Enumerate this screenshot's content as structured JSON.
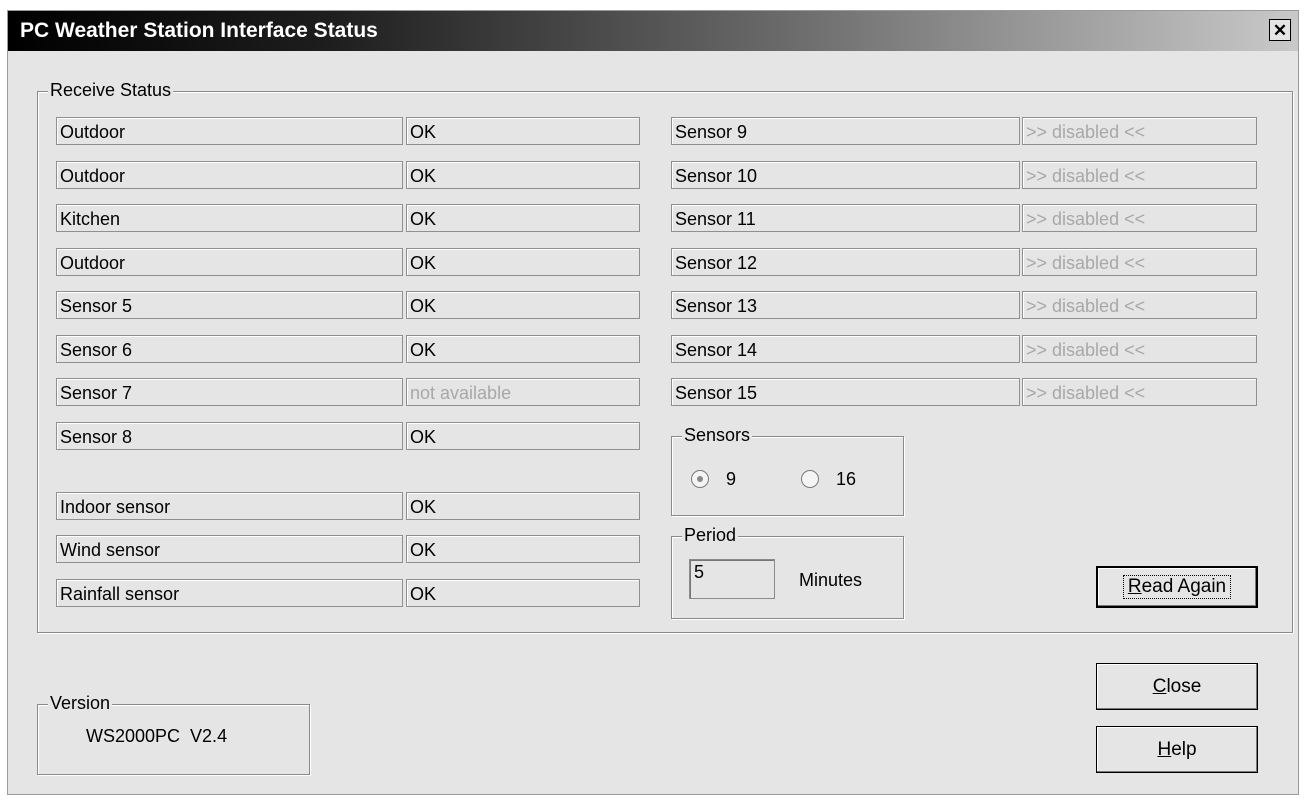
{
  "window": {
    "title": "PC Weather Station Interface Status",
    "close_glyph": "✕"
  },
  "receive_status": {
    "label": "Receive Status",
    "left_rows": [
      {
        "name": "Outdoor",
        "status": "OK"
      },
      {
        "name": "Outdoor",
        "status": "OK"
      },
      {
        "name": "Kitchen",
        "status": "OK"
      },
      {
        "name": "Outdoor",
        "status": "OK"
      },
      {
        "name": "Sensor 5",
        "status": "OK"
      },
      {
        "name": "Sensor 6",
        "status": "OK"
      },
      {
        "name": "Sensor 7",
        "status": "not available"
      },
      {
        "name": "Sensor 8",
        "status": "OK"
      }
    ],
    "extra_rows": [
      {
        "name": "Indoor sensor",
        "status": "OK"
      },
      {
        "name": "Wind sensor",
        "status": "OK"
      },
      {
        "name": "Rainfall sensor",
        "status": "OK"
      }
    ],
    "right_rows": [
      {
        "name": "Sensor 9",
        "status": ">> disabled <<"
      },
      {
        "name": "Sensor 10",
        "status": ">> disabled <<"
      },
      {
        "name": "Sensor 11",
        "status": ">> disabled <<"
      },
      {
        "name": "Sensor 12",
        "status": ">> disabled <<"
      },
      {
        "name": "Sensor 13",
        "status": ">> disabled <<"
      },
      {
        "name": "Sensor 14",
        "status": ">> disabled <<"
      },
      {
        "name": "Sensor 15",
        "status": ">> disabled <<"
      }
    ]
  },
  "sensors": {
    "label": "Sensors",
    "options": [
      "9",
      "16"
    ],
    "selected": "9"
  },
  "period": {
    "label": "Period",
    "value": "5",
    "unit": "Minutes"
  },
  "buttons": {
    "read_again": {
      "mnemonic": "R",
      "rest": "ead Again"
    },
    "close": {
      "mnemonic": "C",
      "rest": "lose"
    },
    "help": {
      "mnemonic": "H",
      "rest": "elp"
    }
  },
  "version": {
    "label": "Version",
    "value": "WS2000PC  V2.4"
  }
}
